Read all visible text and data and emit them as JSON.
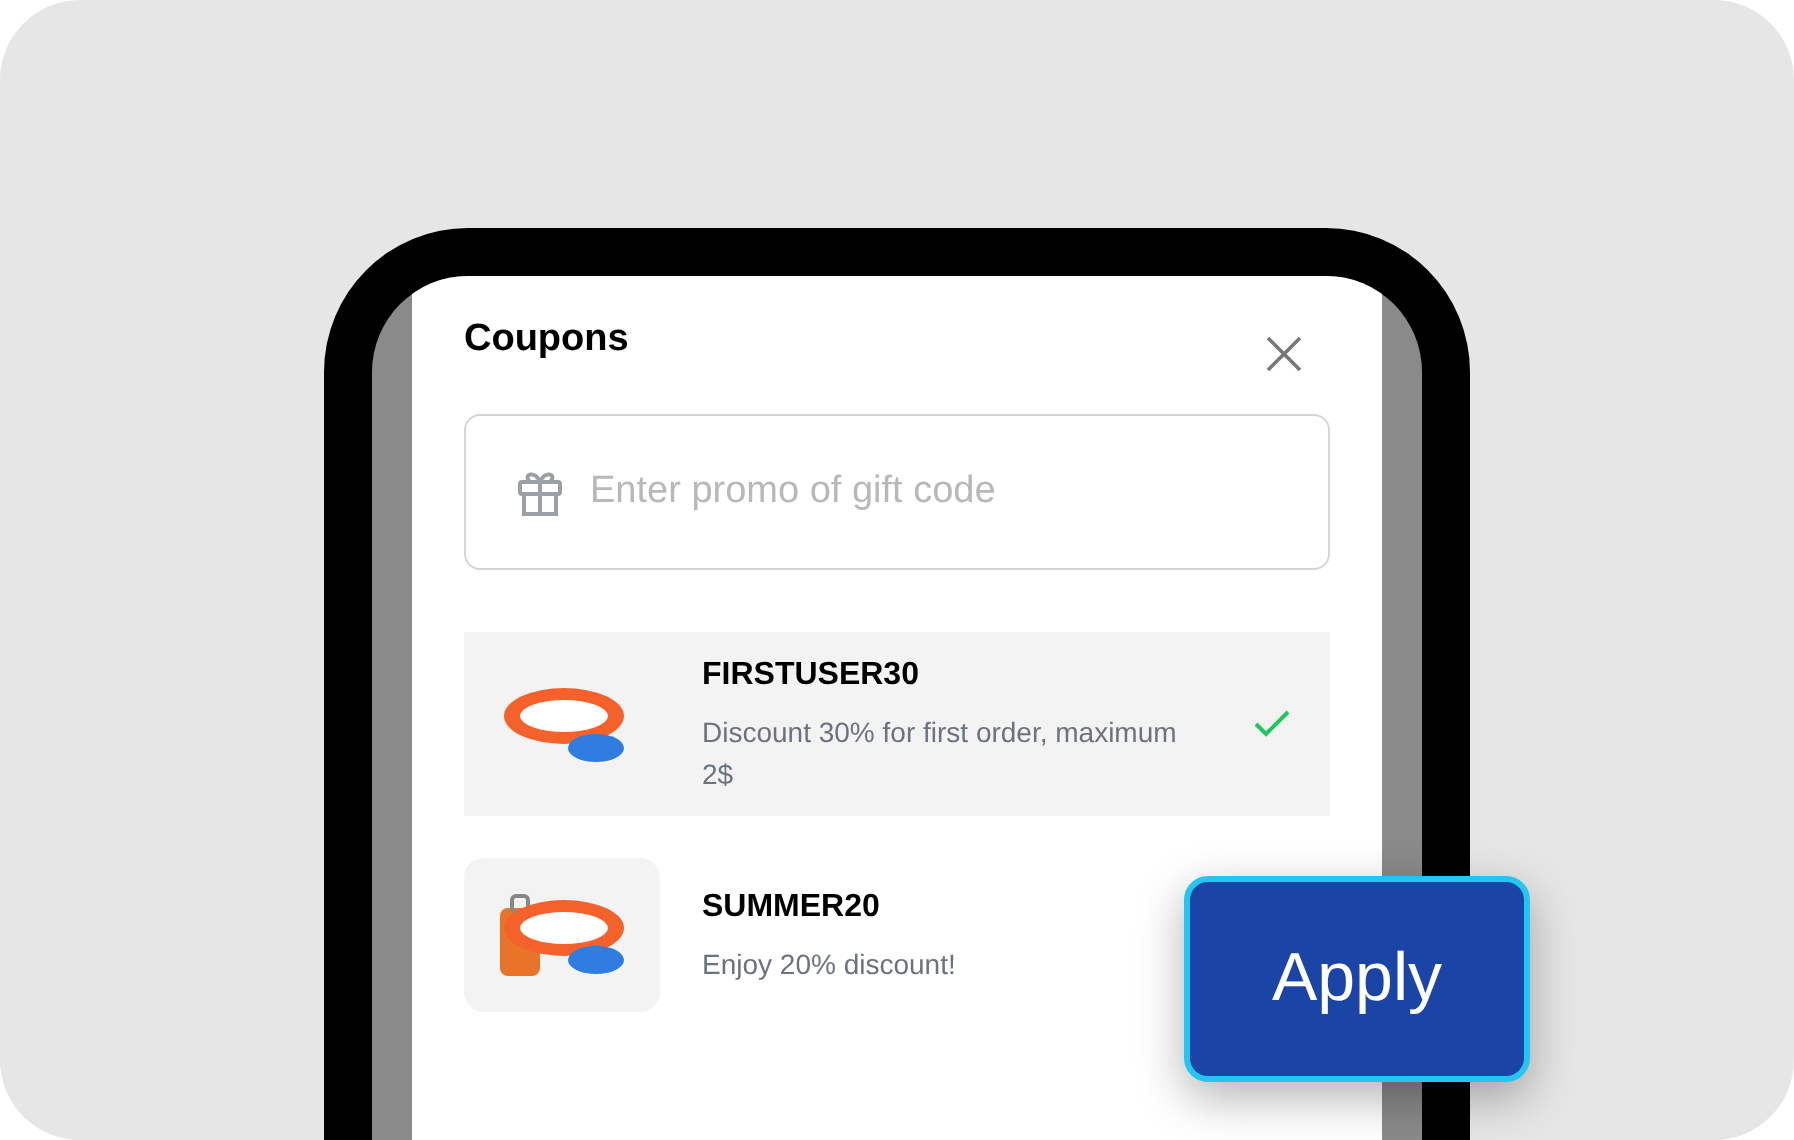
{
  "sheet": {
    "title": "Coupons",
    "promo_field": {
      "placeholder": "Enter promo of gift code"
    }
  },
  "coupons": [
    {
      "code": "FIRSTUSER30",
      "description": "Discount 30% for first order, maximum 2$",
      "selected": true,
      "kind": "plain"
    },
    {
      "code": "SUMMER20",
      "description": "Enjoy 20% discount!",
      "selected": false,
      "kind": "suitcase"
    }
  ],
  "apply_button": {
    "label": "Apply"
  }
}
